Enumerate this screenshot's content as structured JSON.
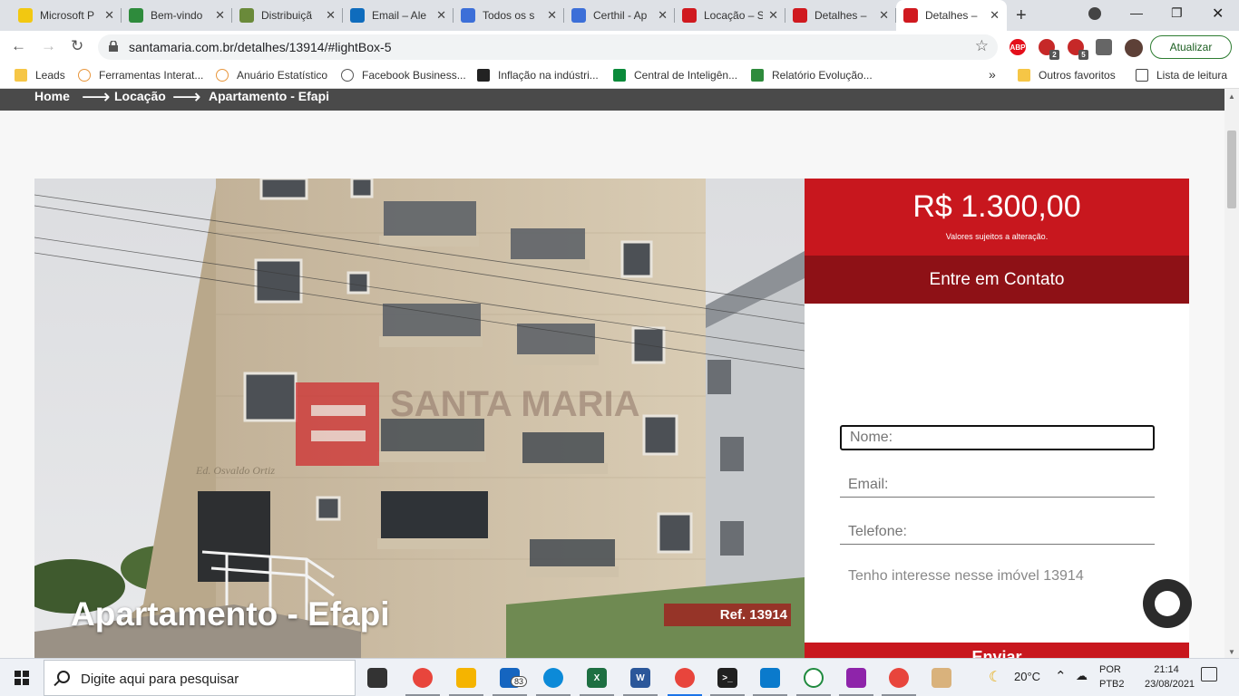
{
  "browser": {
    "tabs": [
      {
        "label": "Microsoft P",
        "icon": "powerbi-icon",
        "color": "#f2c811"
      },
      {
        "label": "Bem-vindo",
        "icon": "brazil-flag-icon",
        "color": "#2e8b3c"
      },
      {
        "label": "Distribuiçã",
        "icon": "crest-icon",
        "color": "#6a8a3a"
      },
      {
        "label": "Email – Ale",
        "icon": "outlook-icon",
        "color": "#0f6cbd"
      },
      {
        "label": "Todos os s",
        "icon": "certhil-icon",
        "color": "#3c6fd8"
      },
      {
        "label": "Certhil - Ap",
        "icon": "certhil-icon",
        "color": "#3c6fd8"
      },
      {
        "label": "Locação – S",
        "icon": "santamaria-icon",
        "color": "#d0191f"
      },
      {
        "label": "Detalhes –",
        "icon": "santamaria-icon",
        "color": "#d0191f"
      },
      {
        "label": "Detalhes –",
        "icon": "santamaria-icon",
        "color": "#d0191f",
        "active": true
      }
    ],
    "url": "santamaria.com.br/detalhes/13914/#lightBox-5",
    "update_label": "Atualizar",
    "extensions": [
      {
        "name": "adblock-icon",
        "text": "ABP",
        "color": "#e40f1b"
      },
      {
        "name": "extension-red-icon",
        "text": "",
        "badge": "2",
        "color": "#c62828"
      },
      {
        "name": "extension-lock-icon",
        "text": "",
        "badge": "5",
        "color": "#c62828"
      }
    ],
    "bookmarks": [
      {
        "label": "Leads",
        "icon": "folder-icon"
      },
      {
        "label": "Ferramentas Interat...",
        "icon": "loading-icon"
      },
      {
        "label": "Anuário Estatístico",
        "icon": "loading-icon"
      },
      {
        "label": "Facebook Business...",
        "icon": "facebook-icon"
      },
      {
        "label": "Inflação na indústri...",
        "icon": "chart-icon"
      },
      {
        "label": "Central de Inteligên...",
        "icon": "bookmark-green-icon"
      },
      {
        "label": "Relatório Evolução...",
        "icon": "brazil-flag-icon"
      }
    ],
    "more_bookmarks": "»",
    "other_favorites": "Outros favoritos",
    "reading_list": "Lista de leitura"
  },
  "page": {
    "breadcrumb": [
      "Home",
      "Locação",
      "Apartamento - Efapi"
    ],
    "property_title": "Apartamento - Efapi",
    "ref_label": "Ref. 13914",
    "watermark": "SANTA MARIA",
    "building_sign": "Ed. Osvaldo Ortiz"
  },
  "contact": {
    "price": "R$ 1.300,00",
    "price_note": "Valores sujeitos a alteração.",
    "heading": "Entre em Contato",
    "name_placeholder": "Nome:",
    "email_placeholder": "Email:",
    "phone_placeholder": "Telefone:",
    "message_value": "Tenho interesse nesse imóvel 13914",
    "send_label": "Enviar"
  },
  "taskbar": {
    "search_placeholder": "Digite aqui para pesquisar",
    "mail_badge": "83",
    "temperature": "20°C",
    "lang_top": "POR",
    "lang_bottom": "PTB2",
    "time": "21:14",
    "date": "23/08/2021",
    "apps": [
      {
        "name": "task-view-icon",
        "color": "#333333",
        "text": ""
      },
      {
        "name": "chrome-icon",
        "color": "#e8453c",
        "text": ""
      },
      {
        "name": "file-explorer-icon",
        "color": "#f5b400",
        "text": ""
      },
      {
        "name": "mail-icon",
        "color": "#1565c0",
        "text": ""
      },
      {
        "name": "edge-icon",
        "color": "#0c8ad8",
        "text": ""
      },
      {
        "name": "excel-icon",
        "color": "#1d6f42",
        "text": "X"
      },
      {
        "name": "word-icon",
        "color": "#2b579a",
        "text": "W"
      },
      {
        "name": "chrome-profile-icon",
        "color": "#e8453c",
        "text": ""
      },
      {
        "name": "terminal-icon",
        "color": "#202020",
        "text": ">_"
      },
      {
        "name": "vscode-icon",
        "color": "#0a7acc",
        "text": ""
      },
      {
        "name": "app-green-icon",
        "color": "#ffffff",
        "text": ""
      },
      {
        "name": "app-colorful-icon",
        "color": "#8e24aa",
        "text": ""
      },
      {
        "name": "chrome-secondary-icon",
        "color": "#e8453c",
        "text": ""
      },
      {
        "name": "paint-icon",
        "color": "#d9b27c",
        "text": ""
      }
    ]
  },
  "colors": {
    "brand_red": "#c8171e",
    "brand_dark_red": "#8e1116",
    "breadcrumb_bg": "#4a4a4a"
  }
}
